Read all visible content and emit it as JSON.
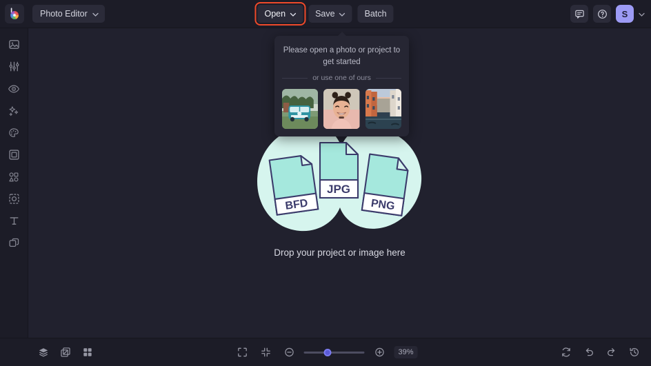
{
  "header": {
    "logo_icon": "befunky-logo-icon",
    "mode_label": "Photo Editor",
    "mode_chevron": "chevron-down-icon",
    "open_label": "Open",
    "open_chevron": "chevron-down-icon",
    "save_label": "Save",
    "save_chevron": "chevron-down-icon",
    "batch_label": "Batch",
    "feedback_icon": "chat-bubble-icon",
    "help_icon": "help-circle-icon",
    "avatar_initial": "S",
    "avatar_chevron": "chevron-down-icon",
    "highlight_color": "#f04a2a"
  },
  "sidebar": {
    "items": [
      {
        "icon": "image-icon",
        "name": "edit"
      },
      {
        "icon": "sliders-icon",
        "name": "adjust"
      },
      {
        "icon": "eye-icon",
        "name": "retouch"
      },
      {
        "icon": "sparkles-icon",
        "name": "effects"
      },
      {
        "icon": "palette-icon",
        "name": "artsy"
      },
      {
        "icon": "frame-icon",
        "name": "frames"
      },
      {
        "icon": "shapes-icon",
        "name": "graphics"
      },
      {
        "icon": "cutout-icon",
        "name": "textures"
      },
      {
        "icon": "text-icon",
        "name": "text"
      },
      {
        "icon": "layers-icon",
        "name": "layers"
      }
    ]
  },
  "popup": {
    "title": "Please open a photo or project to get started",
    "separator_label": "or use one of ours",
    "thumbnails": [
      {
        "name": "vw-bus-photo",
        "alt": "Teal VW bus on grass"
      },
      {
        "name": "portrait-photo",
        "alt": "Smiling woman portrait"
      },
      {
        "name": "venice-canal-photo",
        "alt": "Venice canal at sunset"
      }
    ]
  },
  "drop_zone": {
    "message": "Drop your project or image here",
    "file_cards": [
      {
        "label": "BFD"
      },
      {
        "label": "JPG"
      },
      {
        "label": "PNG"
      }
    ],
    "blob_color": "#d6f5ee",
    "card_color": "#a5e8dd",
    "card_stroke": "#3b3b6b"
  },
  "footer": {
    "left_tools": [
      {
        "icon": "layers-stack-icon",
        "name": "layers-panel"
      },
      {
        "icon": "transform-icon",
        "name": "transform"
      },
      {
        "icon": "grid-icon",
        "name": "grid"
      }
    ],
    "fit_icon": "fit-screen-icon",
    "actual_icon": "actual-size-icon",
    "zoom_out_icon": "zoom-out-icon",
    "zoom_in_icon": "zoom-in-icon",
    "zoom_value": "39%",
    "zoom_percent": 39,
    "right_tools": [
      {
        "icon": "reset-icon",
        "name": "reset"
      },
      {
        "icon": "undo-icon",
        "name": "undo"
      },
      {
        "icon": "redo-icon",
        "name": "redo"
      },
      {
        "icon": "history-icon",
        "name": "history"
      }
    ]
  }
}
